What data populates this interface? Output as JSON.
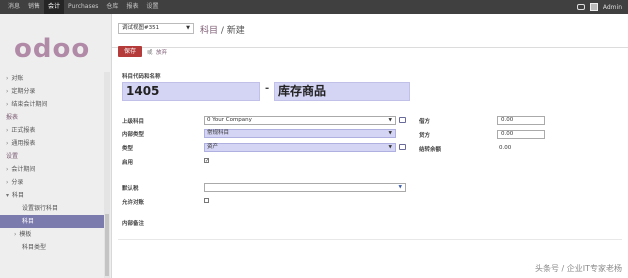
{
  "topbar": {
    "menu": [
      "消息",
      "销售",
      "会计",
      "Purchases",
      "仓库",
      "报表",
      "设置"
    ],
    "active_index": 2,
    "user": "Admin"
  },
  "sidebar": {
    "logo": "odoo",
    "items": [
      {
        "label": "对账",
        "type": "caret"
      },
      {
        "label": "定期分录",
        "type": "caret"
      },
      {
        "label": "结束会计期间",
        "type": "caret"
      },
      {
        "label": "报表",
        "type": "section"
      },
      {
        "label": "正式报表",
        "type": "caret"
      },
      {
        "label": "通用报表",
        "type": "caret"
      },
      {
        "label": "设置",
        "type": "section"
      },
      {
        "label": "会计期间",
        "type": "caret"
      },
      {
        "label": "分录",
        "type": "caret"
      },
      {
        "label": "科目",
        "type": "open"
      },
      {
        "label": "设置银行科目",
        "type": "sub"
      },
      {
        "label": "科目",
        "type": "sub-active"
      },
      {
        "label": "模板",
        "type": "caret-sub"
      },
      {
        "label": "科目类型",
        "type": "sub"
      }
    ]
  },
  "viewbar": {
    "debug_view": "调试视图#351",
    "breadcrumb_link": "科目",
    "breadcrumb_sep": " / ",
    "breadcrumb_current": "新建",
    "save_label": "保存",
    "or_label": "或",
    "discard_label": "放弃"
  },
  "form": {
    "code_name_label": "科目代码和名称",
    "code": "1405",
    "dash": "-",
    "name": "库存商品",
    "parent_label": "上级科目",
    "parent_value": "0 Your Company",
    "internal_type_label": "内部类型",
    "internal_type_value": "常规科目",
    "type_label": "类型",
    "type_value": "资产",
    "active_label": "启用",
    "active_checked": "✓",
    "debit_label": "借方",
    "debit_value": "0.00",
    "credit_label": "贷方",
    "credit_value": "0.00",
    "balance_label": "结转余额",
    "balance_value": "0.00",
    "default_tax_label": "默认税",
    "allow_reconcile_label": "允许对账",
    "notes_label": "内部备注"
  },
  "watermark": "头条号 / 企业IT专家老杨",
  "colors": {
    "topbar": "#404040",
    "accent": "#7c5b73",
    "save_button": "#b53b3b",
    "required_field": "#d4d4f4",
    "active_nav": "#7c7bad"
  }
}
